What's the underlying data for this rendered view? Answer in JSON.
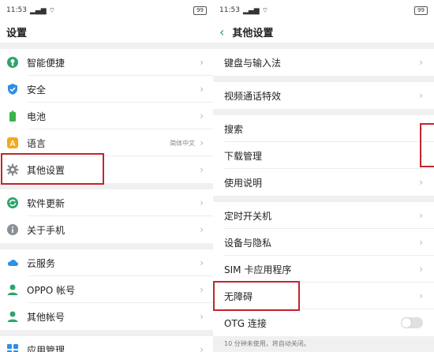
{
  "left": {
    "status": {
      "time": "11:53",
      "signal": "⁵ᵍ",
      "battery": "99"
    },
    "title": "设置",
    "groups": [
      [
        {
          "label": "智能便捷",
          "icon": "smart-icon",
          "color": "#2ea46a"
        },
        {
          "label": "安全",
          "icon": "shield-icon",
          "color": "#2f8ee6"
        },
        {
          "label": "电池",
          "icon": "battery-icon",
          "color": "#38b44a"
        },
        {
          "label": "语言",
          "icon": "language-icon",
          "color": "#f2a91c",
          "value": "简体中文"
        },
        {
          "label": "其他设置",
          "icon": "gear-icon",
          "color": "#888888"
        }
      ],
      [
        {
          "label": "软件更新",
          "icon": "update-icon",
          "color": "#2ea46a"
        },
        {
          "label": "关于手机",
          "icon": "info-icon",
          "color": "#8b8f99"
        }
      ],
      [
        {
          "label": "云服务",
          "icon": "cloud-icon",
          "color": "#2f8ee6"
        },
        {
          "label": "OPPO 帐号",
          "icon": "user-icon",
          "color": "#2ea46a"
        },
        {
          "label": "其他帐号",
          "icon": "user-icon",
          "color": "#2ea46a"
        }
      ],
      [
        {
          "label": "应用管理",
          "icon": "apps-icon",
          "color": "#2f8ee6"
        }
      ]
    ]
  },
  "right": {
    "status": {
      "time": "11:53",
      "signal": "⁵ᵍ",
      "battery": "99"
    },
    "title": "其他设置",
    "groups": [
      [
        {
          "label": "键盘与输入法"
        }
      ],
      [
        {
          "label": "视频通话特效"
        }
      ],
      [
        {
          "label": "搜索"
        },
        {
          "label": "下载管理"
        },
        {
          "label": "使用说明"
        }
      ],
      [
        {
          "label": "定时开关机"
        },
        {
          "label": "设备与隐私"
        },
        {
          "label": "SIM 卡应用程序"
        },
        {
          "label": "无障碍"
        },
        {
          "label": "OTG 连接",
          "toggle": false
        }
      ]
    ],
    "footnote": "10 分钟未使用，将自动关闭。"
  },
  "chevron": "›",
  "highlight_color": "#c0262d"
}
